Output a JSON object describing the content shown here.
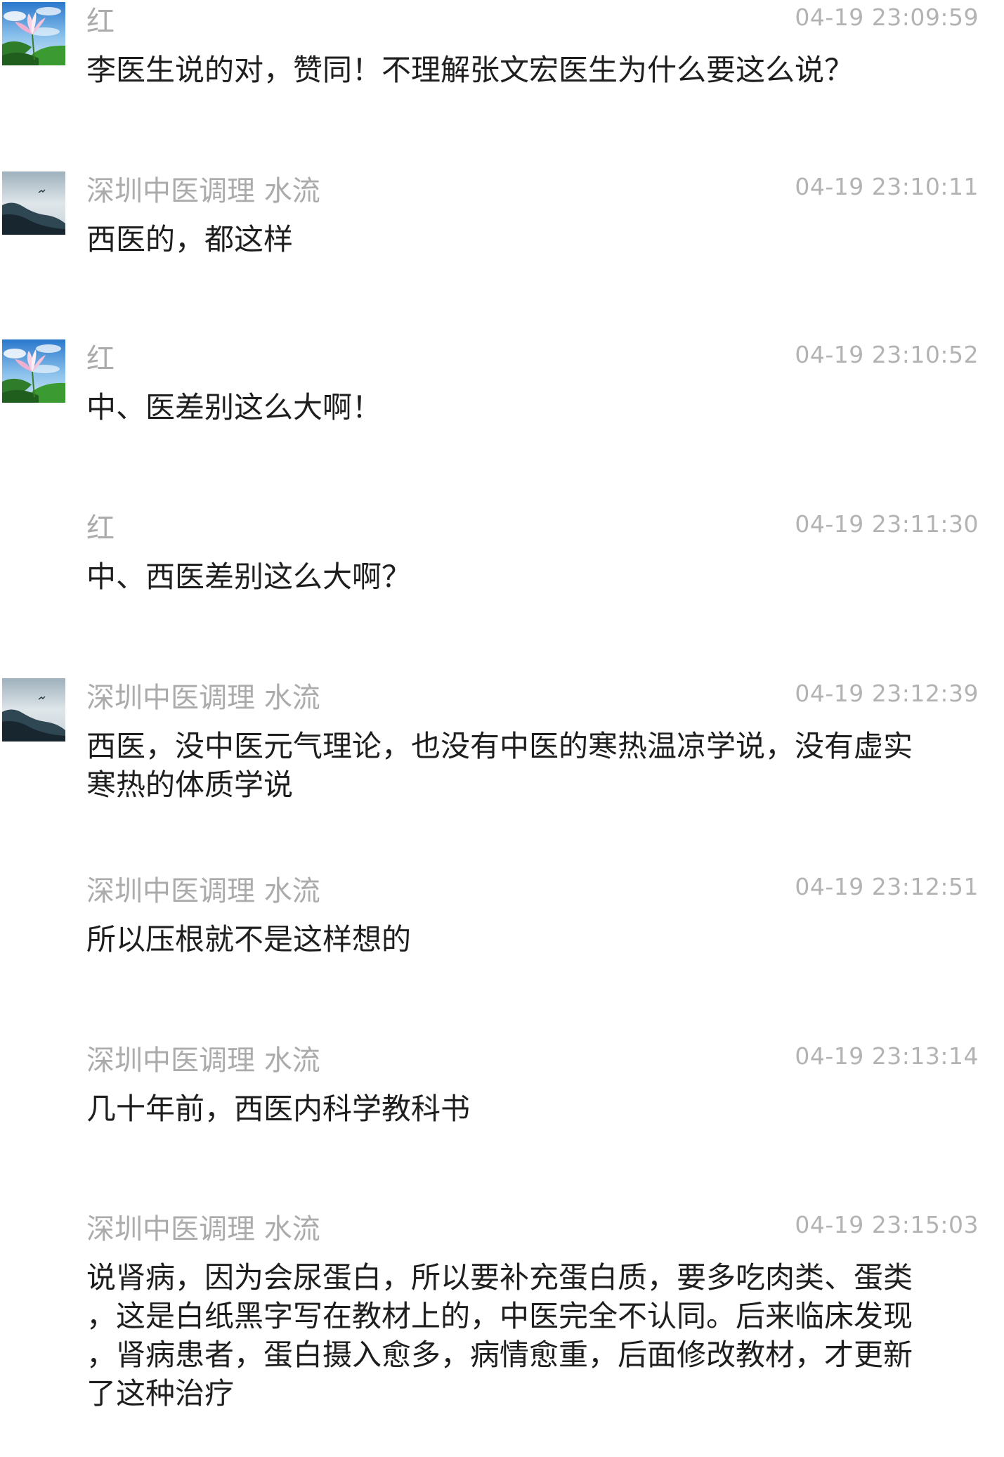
{
  "colors": {
    "background": "#ffffff",
    "sender": "#ababab",
    "time": "#b3b3b3",
    "text": "#1e1e1e"
  },
  "messages": [
    {
      "avatar": "lotus-avatar",
      "sender": "红",
      "time": "04-19 23:09:59",
      "lines": [
        "李医生说的对，赞同！不理解张文宏医生为什么要这么说？"
      ]
    },
    {
      "avatar": "mountain-avatar",
      "sender": "深圳中医调理 水流",
      "time": "04-19 23:10:11",
      "lines": [
        "西医的，都这样"
      ]
    },
    {
      "avatar": "lotus-avatar",
      "sender": "红",
      "time": "04-19 23:10:52",
      "lines": [
        "中、医差别这么大啊！"
      ]
    },
    {
      "avatar": null,
      "sender": "红",
      "time": "04-19 23:11:30",
      "lines": [
        "中、西医差别这么大啊？"
      ]
    },
    {
      "avatar": "mountain-avatar",
      "sender": "深圳中医调理 水流",
      "time": "04-19 23:12:39",
      "lines": [
        "西医，没中医元气理论，也没有中医的寒热温凉学说，没有虚实",
        "寒热的体质学说"
      ]
    },
    {
      "avatar": null,
      "sender": "深圳中医调理 水流",
      "time": "04-19 23:12:51",
      "lines": [
        "所以压根就不是这样想的"
      ]
    },
    {
      "avatar": null,
      "sender": "深圳中医调理 水流",
      "time": "04-19 23:13:14",
      "lines": [
        "几十年前，西医内科学教科书"
      ]
    },
    {
      "avatar": null,
      "sender": "深圳中医调理 水流",
      "time": "04-19 23:15:03",
      "lines": [
        "说肾病，因为会尿蛋白，所以要补充蛋白质，要多吃肉类、蛋类",
        "，这是白纸黑字写在教材上的，中医完全不认同。后来临床发现",
        "，肾病患者，蛋白摄入愈多，病情愈重，后面修改教材，才更新",
        "了这种治疗"
      ]
    }
  ]
}
